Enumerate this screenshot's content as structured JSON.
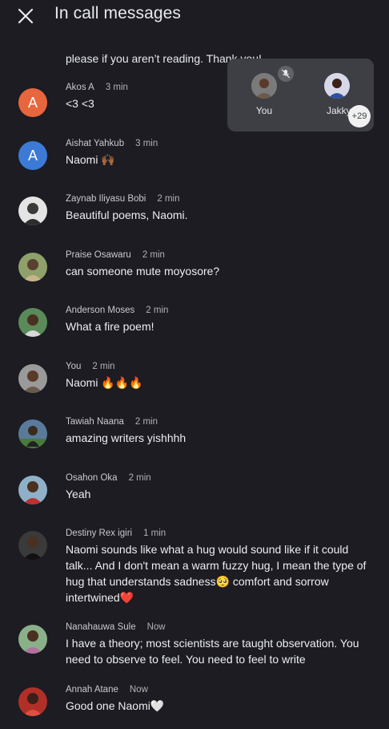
{
  "header": {
    "title": "In call messages"
  },
  "partial_message": {
    "text": "please if you aren’t reading. Thank you!"
  },
  "popup": {
    "you_label": "You",
    "jakky_label": "Jakky",
    "more_count": "+29"
  },
  "messages": [
    {
      "name": "Akos A",
      "time": "3 min",
      "text": "<3 <3",
      "avatar_letter": "A",
      "avatar_color": "#e8663d"
    },
    {
      "name": "Aishat Yahkub",
      "time": "3 min",
      "text": "Naomi 🙌🏾",
      "avatar_letter": "A",
      "avatar_color": "#3c7ad6"
    },
    {
      "name": "Zaynab Iliyasu Bobi",
      "time": "2 min",
      "text": "Beautiful poems, Naomi."
    },
    {
      "name": "Praise Osawaru",
      "time": "2 min",
      "text": "can someone mute moyosore?"
    },
    {
      "name": "Anderson Moses",
      "time": "2 min",
      "text": "What a fire poem!"
    },
    {
      "name": "You",
      "time": "2 min",
      "text": "Naomi 🔥🔥🔥"
    },
    {
      "name": "Tawiah Naana",
      "time": "2 min",
      "text": "amazing writers yishhhh"
    },
    {
      "name": "Osahon Oka",
      "time": "2 min",
      "text": "Yeah"
    },
    {
      "name": "Destiny Rex igiri",
      "time": "1 min",
      "text": "Naomi sounds like what a hug would sound like if it could talk... And I don't mean a warm fuzzy hug, I mean the type of hug that understands sadness🥺 comfort and sorrow intertwined❤️"
    },
    {
      "name": "Nanahauwa Sule",
      "time": "Now",
      "text": "I have a theory; most scientists are taught observation. You need to observe to feel. You need to feel to write"
    },
    {
      "name": "Annah Atane",
      "time": "Now",
      "text": "Good one Naomi🤍"
    }
  ]
}
